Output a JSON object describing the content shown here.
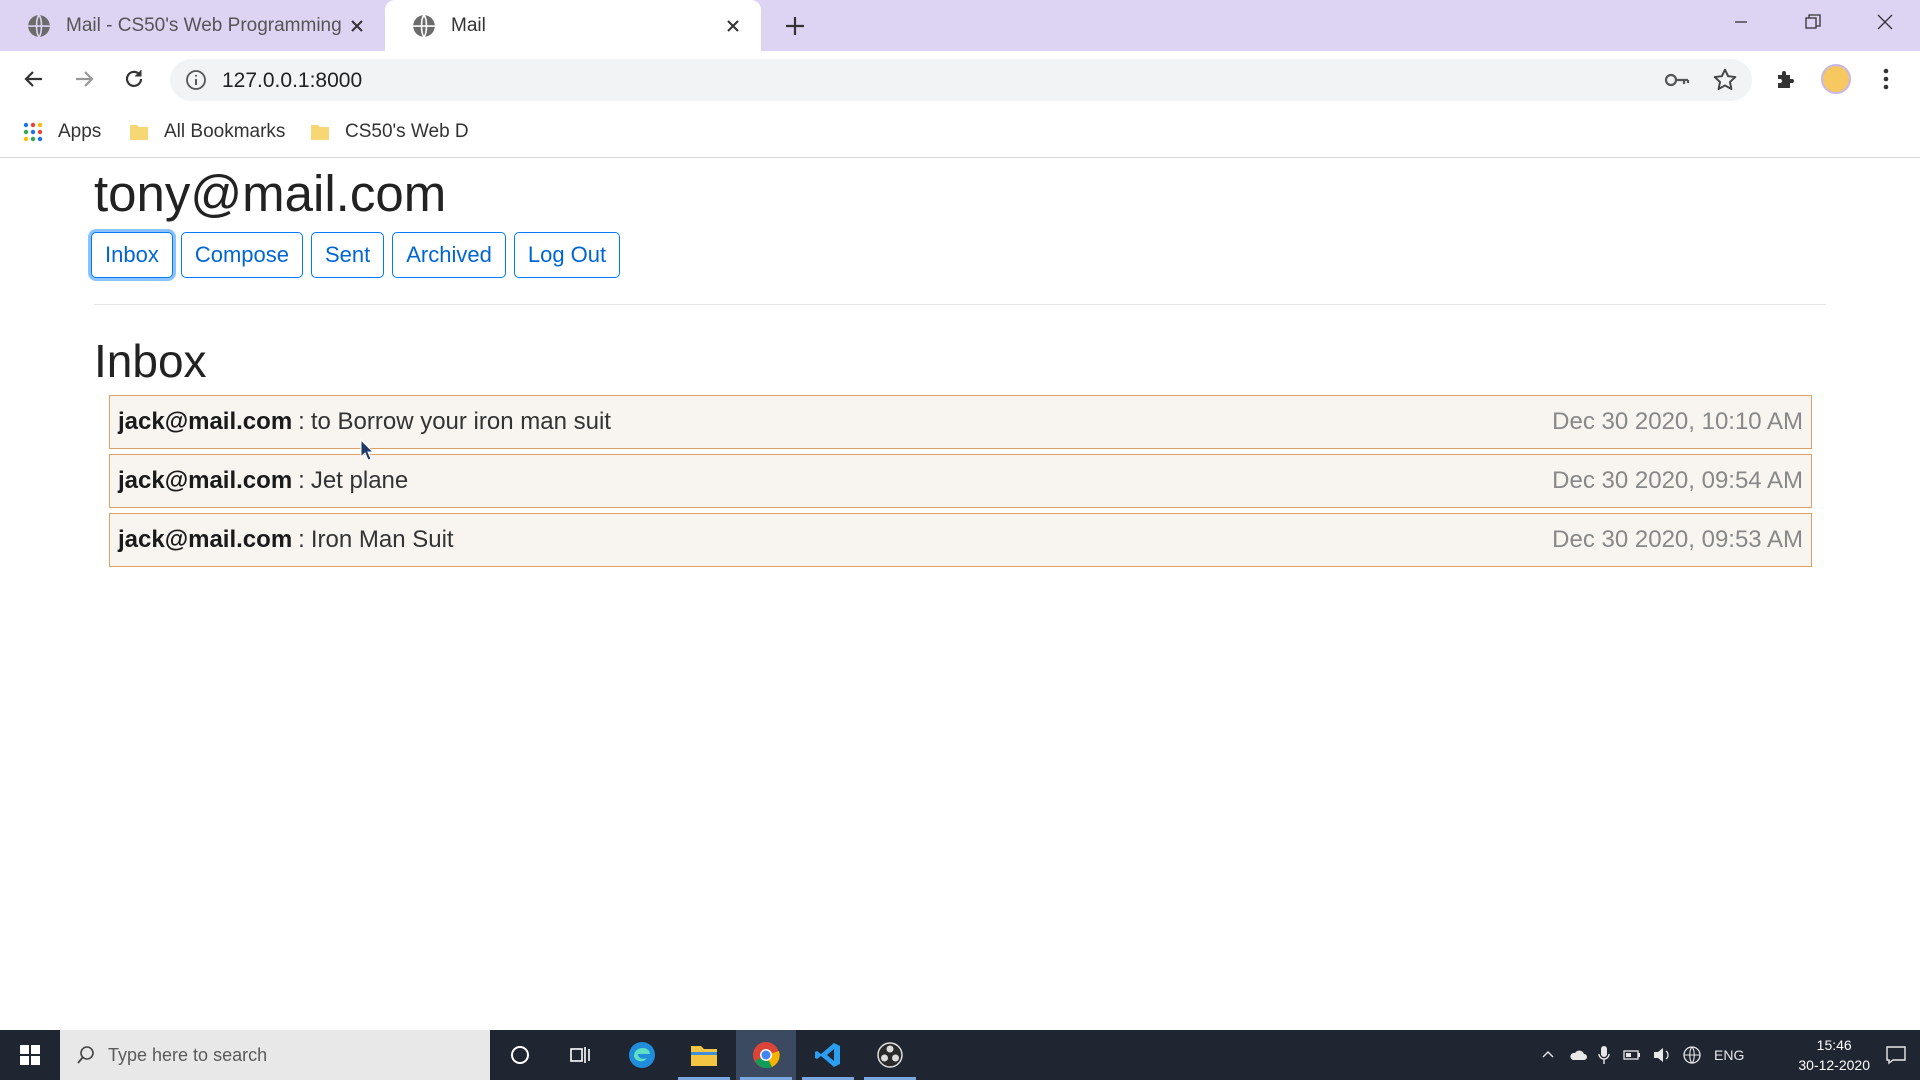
{
  "browser": {
    "tabs": [
      {
        "title": "Mail - CS50's Web Programming",
        "active": false
      },
      {
        "title": "Mail",
        "active": true
      }
    ],
    "url": "127.0.0.1:8000",
    "bookmarks": [
      {
        "label": "Apps",
        "icon": "apps-grid-icon"
      },
      {
        "label": "All Bookmarks",
        "icon": "folder-icon"
      },
      {
        "label": "CS50's Web D",
        "icon": "folder-icon"
      }
    ]
  },
  "page": {
    "user_email": "tony@mail.com",
    "nav": {
      "inbox": "Inbox",
      "compose": "Compose",
      "sent": "Sent",
      "archived": "Archived",
      "logout": "Log Out"
    },
    "section_title": "Inbox",
    "emails": [
      {
        "sender": "jack@mail.com",
        "separator": ":",
        "subject": "to Borrow your iron man suit",
        "timestamp": "Dec 30 2020, 10:10 AM"
      },
      {
        "sender": "jack@mail.com",
        "separator": ":",
        "subject": "Jet plane",
        "timestamp": "Dec 30 2020, 09:54 AM"
      },
      {
        "sender": "jack@mail.com",
        "separator": ":",
        "subject": "Iron Man Suit",
        "timestamp": "Dec 30 2020, 09:53 AM"
      }
    ]
  },
  "taskbar": {
    "search_placeholder": "Type here to search",
    "language": "ENG",
    "time": "15:46",
    "date": "30-12-2020"
  },
  "colors": {
    "tabstrip": "#ddd3f2",
    "primary_button": "#007bff",
    "email_border": "#e0a063",
    "email_bg": "#f8f5f1",
    "taskbar": "#1f2632"
  }
}
